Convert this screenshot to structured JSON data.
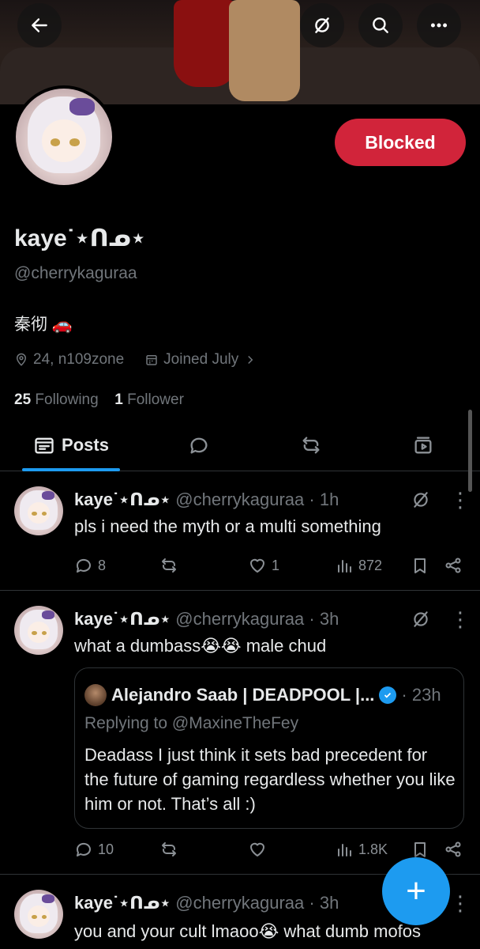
{
  "profile": {
    "name": "kaye˙⋆ᑎᓄ⋆",
    "handle": "@cherrykaguraa",
    "bio": "秦彻 🚗",
    "location": "24, n109zone",
    "joined": "Joined July",
    "following_count": "25",
    "following_label": "Following",
    "followers_count": "1",
    "followers_label": "Follower",
    "blocked_label": "Blocked"
  },
  "tabs": {
    "posts_label": "Posts"
  },
  "posts": [
    {
      "name": "kaye˙⋆ᑎᓄ⋆",
      "handle": "@cherrykaguraa",
      "time": "· 1h",
      "text": "pls i need the myth or a multi something",
      "replies": "8",
      "reposts": "",
      "likes": "1",
      "views": "872"
    },
    {
      "name": "kaye˙⋆ᑎᓄ⋆",
      "handle": "@cherrykaguraa",
      "time": "· 3h",
      "text": "what a dumbass😭😭 male chud",
      "replies": "10",
      "reposts": "",
      "likes": "",
      "views": "1.8K",
      "quote": {
        "name": "Alejandro Saab | DEADPOOL |...",
        "time": "· 23h",
        "replying_prefix": "Replying to",
        "replying_to": "@MaxineTheFey",
        "text": "Deadass I just think it sets bad precedent for the future of gaming regardless whether you like him or not. That’s all :)"
      }
    },
    {
      "name": "kaye˙⋆ᑎᓄ⋆",
      "handle": "@cherrykaguraa",
      "time": "· 3h",
      "text": "you and your cult lmaoo😭 what dumb mofos"
    }
  ],
  "colors": {
    "accent": "#1d9bf0",
    "blocked": "#d1243a",
    "background": "#000000",
    "muted_text": "#71767b"
  },
  "icons": [
    "back-arrow-icon",
    "grok-icon",
    "search-icon",
    "more-icon",
    "location-icon",
    "calendar-icon",
    "chevron-right-icon",
    "reply-icon",
    "repost-icon",
    "like-icon",
    "views-icon",
    "bookmark-icon",
    "share-icon",
    "plus-icon"
  ]
}
